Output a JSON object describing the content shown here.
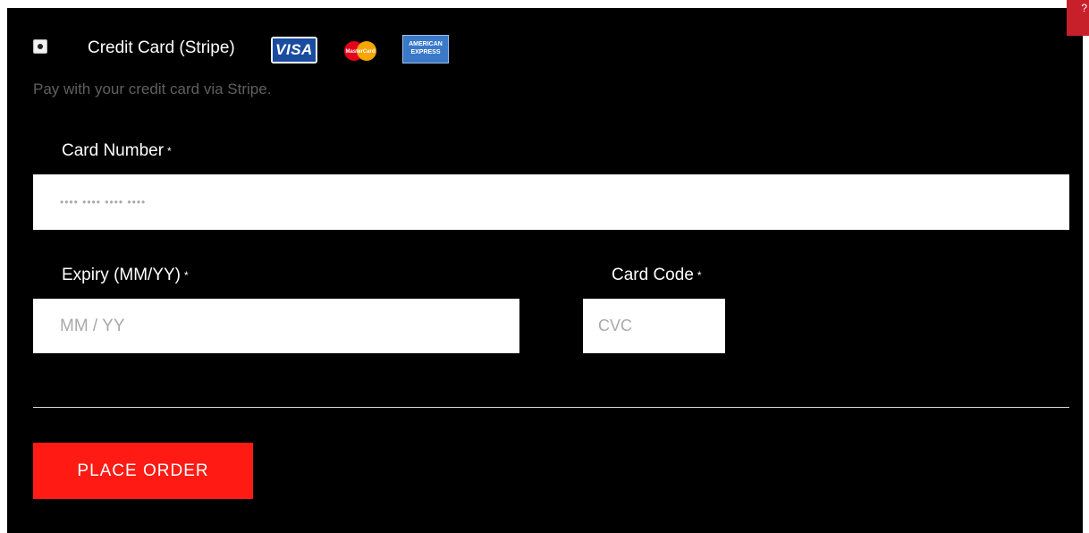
{
  "payment_method": {
    "label": "Credit Card (Stripe)",
    "description": "Pay with your credit card via Stripe.",
    "selected": true,
    "card_icons": {
      "visa": "VISA",
      "mastercard": "MasterCard",
      "amex_line1": "AMERICAN",
      "amex_line2": "EXPRESS"
    }
  },
  "fields": {
    "card_number": {
      "label": "Card Number",
      "required_mark": "*",
      "placeholder": "•••• •••• •••• ••••"
    },
    "expiry": {
      "label": "Expiry (MM/YY)",
      "required_mark": "*",
      "placeholder": "MM / YY"
    },
    "card_code": {
      "label": "Card Code",
      "required_mark": "*",
      "placeholder": "CVC"
    }
  },
  "actions": {
    "place_order_label": "PLACE ORDER"
  },
  "corner_badge": {
    "text": "?"
  },
  "colors": {
    "background": "#000000",
    "button": "#ff1a14",
    "badge": "#c8202a",
    "visa_blue": "#1a4ca0",
    "amex_blue": "#3a78c8"
  }
}
